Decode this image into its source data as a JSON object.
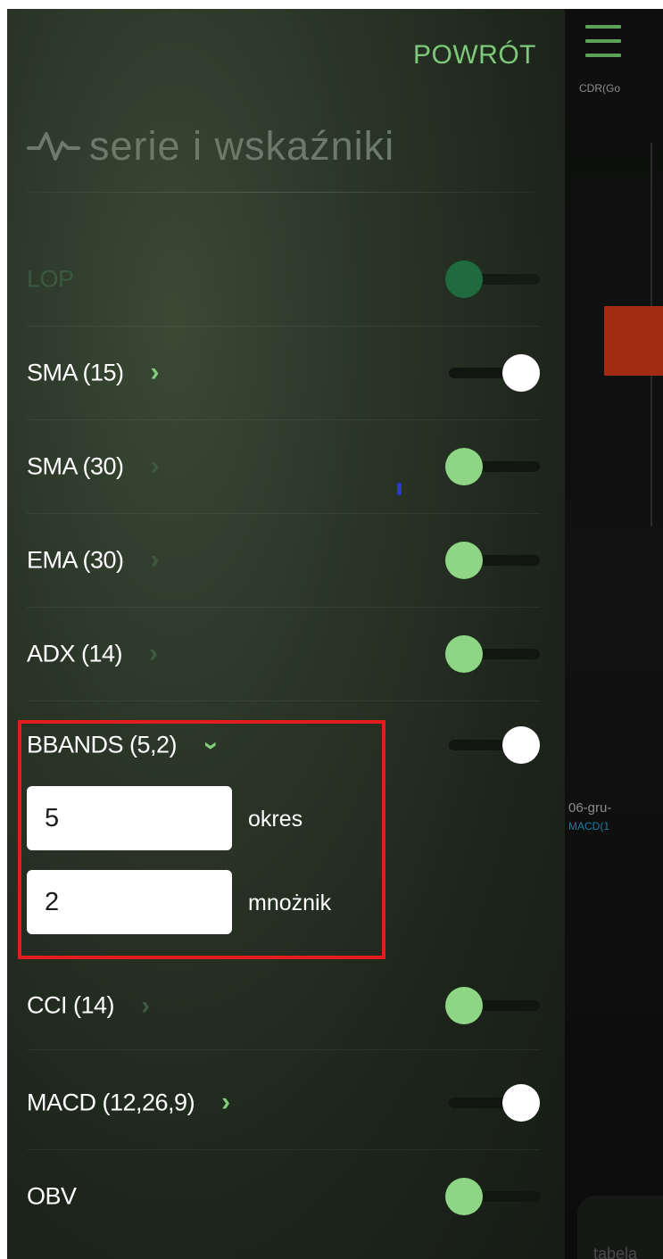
{
  "panel": {
    "back_label": "POWRÓT",
    "title": "serie i wskaźniki",
    "title_icon": "pulse-icon"
  },
  "indicators": [
    {
      "label": "LOP",
      "state": "disabled",
      "chevron": "none"
    },
    {
      "label": "SMA (15)",
      "state": "on",
      "chevron": "bright"
    },
    {
      "label": "SMA (30)",
      "state": "off",
      "chevron": "faint"
    },
    {
      "label": "EMA (30)",
      "state": "off",
      "chevron": "faint"
    },
    {
      "label": "ADX (14)",
      "state": "off",
      "chevron": "faint"
    },
    {
      "label": "BBANDS (5,2)",
      "state": "on",
      "chevron": "expanded"
    },
    {
      "label": "CCI (14)",
      "state": "off",
      "chevron": "faint"
    },
    {
      "label": "MACD (12,26,9)",
      "state": "on",
      "chevron": "bright"
    },
    {
      "label": "OBV",
      "state": "off",
      "chevron": "none"
    }
  ],
  "bbands_params": {
    "period_value": "5",
    "period_label": "okres",
    "multiplier_value": "2",
    "multiplier_label": "mnożnik"
  },
  "chart": {
    "ticker": "CDR(Go",
    "date_label": "06-gru-",
    "macd_label": "MACD(1",
    "tab_label": "tabela"
  },
  "colors": {
    "accent": "#7ec97a",
    "highlight_border": "#e21d1d",
    "candle": "#a22b12"
  }
}
